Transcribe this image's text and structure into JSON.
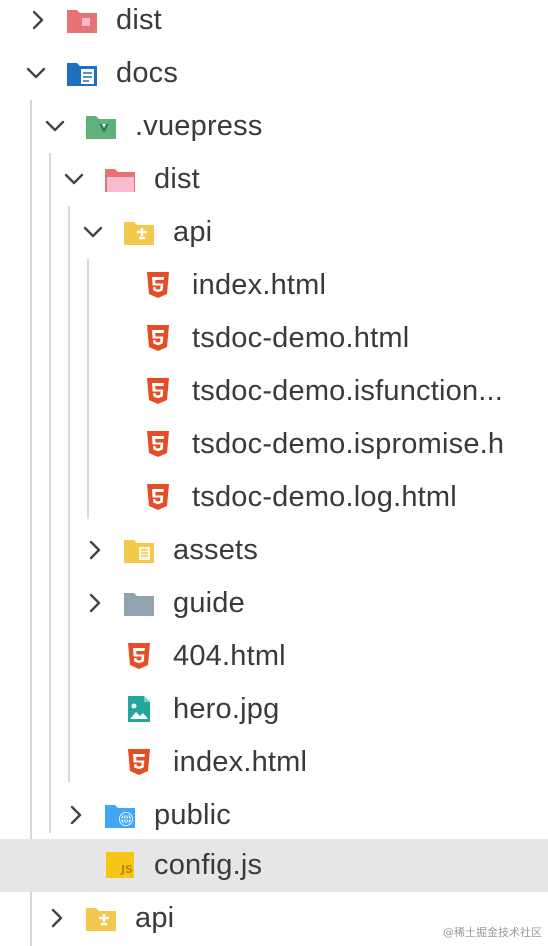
{
  "explorer": {
    "rows": [
      {
        "label": "dist",
        "icon": "dist-folder-icon",
        "expanded": false
      },
      {
        "label": "docs",
        "icon": "docs-folder-icon",
        "expanded": true
      },
      {
        "label": ".vuepress",
        "icon": "vuepress-folder-icon",
        "expanded": true
      },
      {
        "label": "dist",
        "icon": "dist-folder-icon",
        "expanded": true
      },
      {
        "label": "api",
        "icon": "api-folder-icon",
        "expanded": true
      },
      {
        "label": "index.html",
        "icon": "html5-icon"
      },
      {
        "label": "tsdoc-demo.html",
        "icon": "html5-icon"
      },
      {
        "label": "tsdoc-demo.isfunction...",
        "icon": "html5-icon"
      },
      {
        "label": "tsdoc-demo.ispromise.h",
        "icon": "html5-icon"
      },
      {
        "label": "tsdoc-demo.log.html",
        "icon": "html5-icon"
      },
      {
        "label": "assets",
        "icon": "assets-folder-icon",
        "expanded": false
      },
      {
        "label": "guide",
        "icon": "folder-icon",
        "expanded": false
      },
      {
        "label": "404.html",
        "icon": "html5-icon"
      },
      {
        "label": "hero.jpg",
        "icon": "image-icon"
      },
      {
        "label": "index.html",
        "icon": "html5-icon"
      },
      {
        "label": "public",
        "icon": "public-folder-icon",
        "expanded": false
      },
      {
        "label": "config.js",
        "icon": "javascript-icon",
        "selected": true
      },
      {
        "label": "api",
        "icon": "api-folder-icon",
        "expanded": false
      }
    ]
  },
  "watermark": "@稀土掘金技术社区",
  "colors": {
    "selected_row": "#e6e6e6",
    "html5": "#e44d26",
    "folder_yellow": "#f2c94c",
    "folder_red": "#e57373",
    "folder_blue": "#42a5f5",
    "folder_green": "#66bb6a",
    "folder_gray": "#90a4ae"
  }
}
